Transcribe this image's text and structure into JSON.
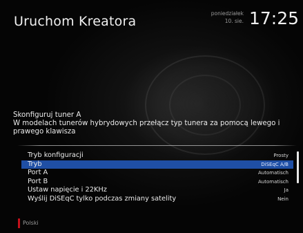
{
  "header": {
    "title": "Uruchom Kreatora",
    "day": "poniedziałek",
    "date": "10. sie.",
    "time": "17:25"
  },
  "description": {
    "line1": "Skonfiguruj tuner A",
    "line2": "W modelach tunerów hybrydowych przełącz typ tunera za pomocą lewego i prawego klawisza"
  },
  "menu": {
    "items": [
      {
        "label": "Tryb konfiguracji",
        "value": "Prosty"
      },
      {
        "label": "Tryb",
        "value": "DiSEqC A/B"
      },
      {
        "label": "Port A",
        "value": "Automatisch"
      },
      {
        "label": "Port B",
        "value": "Automatisch"
      },
      {
        "label": "Ustaw napięcie i 22KHz",
        "value": "Ja"
      },
      {
        "label": "Wyślij DiSEqC tylko podczas zmiany satelity",
        "value": "Nein"
      }
    ],
    "selected_index": 1
  },
  "footer": {
    "language": "Polski",
    "language_mark_color": "#c4101a"
  },
  "colors": {
    "selection": "#1f4fa5",
    "background": "#000000"
  }
}
